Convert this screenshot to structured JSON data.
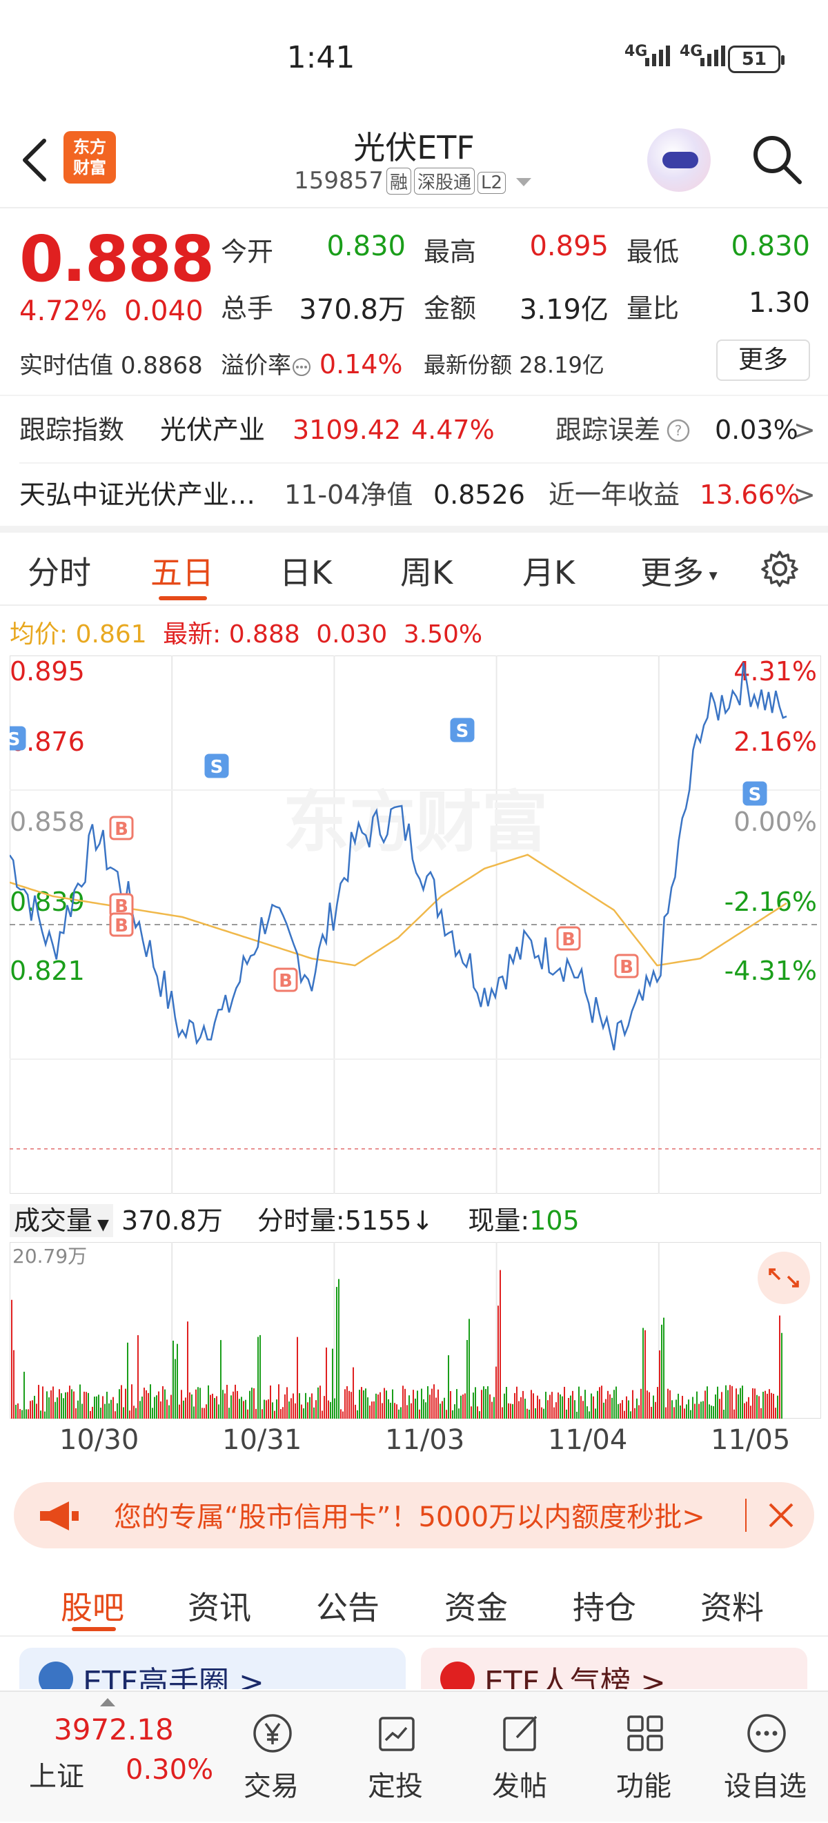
{
  "status_bar": {
    "time": "1:41",
    "signal1": "4G",
    "signal2": "4G",
    "battery": "51"
  },
  "header": {
    "logo_line1": "东方",
    "logo_line2": "财富",
    "title": "光伏ETF",
    "code": "159857",
    "tags": [
      "融",
      "深股通",
      "L2"
    ]
  },
  "quote": {
    "price": "0.888",
    "change_pct": "4.72%",
    "change": "0.040",
    "open_label": "今开",
    "open": "0.830",
    "high_label": "最高",
    "high": "0.895",
    "low_label": "最低",
    "low": "0.830",
    "volume_label": "总手",
    "volume": "370.8万",
    "amount_label": "金额",
    "amount": "3.19亿",
    "ratio_label": "量比",
    "ratio": "1.30",
    "iopv_label": "实时估值",
    "iopv": "0.8868",
    "premium_label": "溢价率",
    "premium": "0.14%",
    "shares_label": "最新份额",
    "shares": "28.19亿",
    "more": "更多"
  },
  "index_row": {
    "label": "跟踪指数",
    "name": "光伏产业",
    "value": "3109.42",
    "pct": "4.47%",
    "err_label": "跟踪误差",
    "err": "0.03%"
  },
  "fund_row": {
    "name": "天弘中证光伏产业…",
    "nav_label": "11-04净值",
    "nav": "0.8526",
    "ret_label": "近一年收益",
    "ret": "13.66%"
  },
  "tabs": [
    "分时",
    "五日",
    "日K",
    "周K",
    "月K",
    "更多"
  ],
  "active_tab": "五日",
  "avg_bar": {
    "avg_label": "均价:",
    "avg": "0.861",
    "latest_label": "最新:",
    "latest": "0.888",
    "chg": "0.030",
    "pct": "3.50%"
  },
  "chart_data": {
    "type": "line",
    "x": [
      "10/30",
      "10/31",
      "11/03",
      "11/04",
      "11/05"
    ],
    "y_labels_left": [
      "0.895",
      "0.876",
      "0.858",
      "0.839",
      "0.821"
    ],
    "y_labels_right": [
      "4.31%",
      "2.16%",
      "0.00%",
      "-2.16%",
      "-4.31%"
    ],
    "ylim": [
      0.821,
      0.895
    ],
    "series": [
      {
        "values": [
          0.868,
          0.854,
          0.871,
          0.858,
          0.842,
          0.845,
          0.86,
          0.85,
          0.87,
          0.874,
          0.86,
          0.848,
          0.855,
          0.852,
          0.84,
          0.85,
          0.887,
          0.893,
          0.888
        ]
      },
      {
        "values": [
          0.864,
          0.862,
          0.861,
          0.86,
          0.859,
          0.857,
          0.855,
          0.853,
          0.852,
          0.856,
          0.862,
          0.866,
          0.868,
          0.864,
          0.86,
          0.852,
          0.853,
          0.857,
          0.861
        ]
      }
    ],
    "markers": [
      "S",
      "S",
      "S",
      "S",
      "B",
      "B",
      "B",
      "B",
      "B",
      "B"
    ],
    "watermark": "东方财富"
  },
  "volume": {
    "label": "成交量",
    "total": "370.8万",
    "tick_label": "分时量:",
    "tick": "5155",
    "cur_label": "现量:",
    "cur": "105",
    "max": "20.79万"
  },
  "ad": {
    "text": "您的专属“股市信用卡”！5000万以内额度秒批>"
  },
  "bottom_tabs": [
    "股吧",
    "资讯",
    "公告",
    "资金",
    "持仓",
    "资料"
  ],
  "cards": [
    "ETF高手圈 >",
    "ETF人气榜 >"
  ],
  "bottom_nav": {
    "index_value": "3972.18",
    "index_name": "上证",
    "index_pct": "0.30%",
    "items": [
      "交易",
      "定投",
      "发帖",
      "功能",
      "设自选"
    ]
  },
  "colors": {
    "up": "#e02020",
    "down": "#1a9e1a",
    "accent": "#e64a19",
    "line": "#3a74c4",
    "avg": "#f0b84a"
  }
}
